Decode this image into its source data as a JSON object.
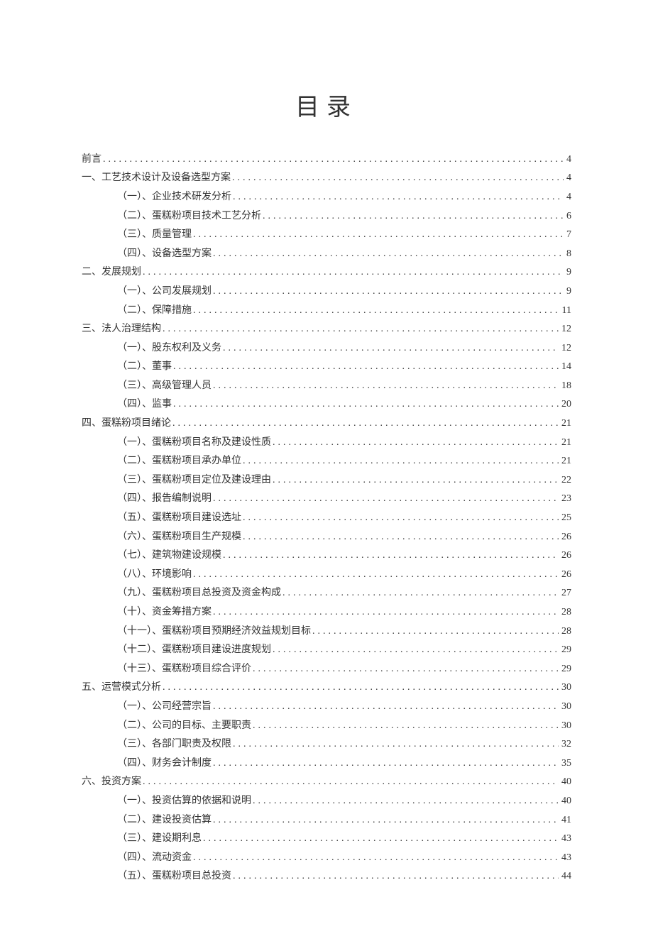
{
  "title": "目录",
  "toc": [
    {
      "level": 1,
      "label": "前言",
      "page": "4"
    },
    {
      "level": 1,
      "label": "一、工艺技术设计及设备选型方案",
      "page": "4"
    },
    {
      "level": 2,
      "label": "（一）、企业技术研发分析",
      "page": "4"
    },
    {
      "level": 2,
      "label": "（二）、蛋糕粉项目技术工艺分析",
      "page": "6"
    },
    {
      "level": 2,
      "label": "（三）、质量管理",
      "page": "7"
    },
    {
      "level": 2,
      "label": "（四）、设备选型方案",
      "page": "8"
    },
    {
      "level": 1,
      "label": "二、发展规划",
      "page": "9"
    },
    {
      "level": 2,
      "label": "（一）、公司发展规划",
      "page": "9"
    },
    {
      "level": 2,
      "label": "（二）、保障措施",
      "page": "11"
    },
    {
      "level": 1,
      "label": "三、法人治理结构",
      "page": "12"
    },
    {
      "level": 2,
      "label": "（一）、股东权利及义务",
      "page": "12"
    },
    {
      "level": 2,
      "label": "（二）、董事",
      "page": "14"
    },
    {
      "level": 2,
      "label": "（三）、高级管理人员",
      "page": "18"
    },
    {
      "level": 2,
      "label": "（四）、监事",
      "page": "20"
    },
    {
      "level": 1,
      "label": "四、蛋糕粉项目绪论",
      "page": "21"
    },
    {
      "level": 2,
      "label": "（一）、蛋糕粉项目名称及建设性质",
      "page": "21"
    },
    {
      "level": 2,
      "label": "（二）、蛋糕粉项目承办单位",
      "page": "21"
    },
    {
      "level": 2,
      "label": "（三）、蛋糕粉项目定位及建设理由",
      "page": "22"
    },
    {
      "level": 2,
      "label": "（四）、报告编制说明",
      "page": "23"
    },
    {
      "level": 2,
      "label": "（五）、蛋糕粉项目建设选址",
      "page": "25"
    },
    {
      "level": 2,
      "label": "（六）、蛋糕粉项目生产规模",
      "page": "26"
    },
    {
      "level": 2,
      "label": "（七）、建筑物建设规模",
      "page": "26"
    },
    {
      "level": 2,
      "label": "（八）、环境影响",
      "page": "26"
    },
    {
      "level": 2,
      "label": "（九）、蛋糕粉项目总投资及资金构成",
      "page": "27"
    },
    {
      "level": 2,
      "label": "（十）、资金筹措方案",
      "page": "28"
    },
    {
      "level": 2,
      "label": "（十一）、蛋糕粉项目预期经济效益规划目标",
      "page": "28"
    },
    {
      "level": 2,
      "label": "（十二）、蛋糕粉项目建设进度规划",
      "page": "29"
    },
    {
      "level": 2,
      "label": "（十三）、蛋糕粉项目综合评价",
      "page": "29"
    },
    {
      "level": 1,
      "label": "五、运营模式分析",
      "page": "30"
    },
    {
      "level": 2,
      "label": "（一）、公司经营宗旨",
      "page": "30"
    },
    {
      "level": 2,
      "label": "（二）、公司的目标、主要职责",
      "page": "30"
    },
    {
      "level": 2,
      "label": "（三）、各部门职责及权限",
      "page": "32"
    },
    {
      "level": 2,
      "label": "（四）、财务会计制度",
      "page": "35"
    },
    {
      "level": 1,
      "label": "六、投资方案",
      "page": "40"
    },
    {
      "level": 2,
      "label": "（一）、投资估算的依据和说明",
      "page": "40"
    },
    {
      "level": 2,
      "label": "（二）、建设投资估算",
      "page": "41"
    },
    {
      "level": 2,
      "label": "（三）、建设期利息",
      "page": "43"
    },
    {
      "level": 2,
      "label": "（四）、流动资金",
      "page": "43"
    },
    {
      "level": 2,
      "label": "（五）、蛋糕粉项目总投资",
      "page": "44"
    }
  ]
}
